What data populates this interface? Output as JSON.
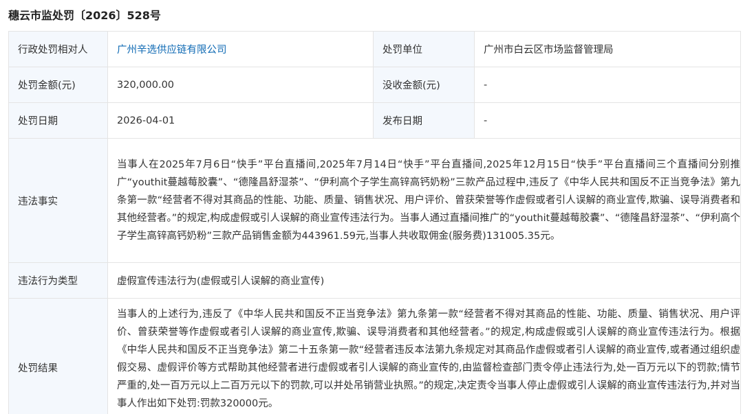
{
  "page_title": "穗云市监处罚〔2026〕528号",
  "rows": {
    "party_label": "行政处罚相对人",
    "party_value": "广州辛选供应链有限公司",
    "unit_label": "处罚单位",
    "unit_value": "广州市白云区市场监督管理局",
    "amount_label": "处罚金额(元)",
    "amount_value": "320,000.00",
    "confiscation_label": "没收金额(元)",
    "confiscation_value": "-",
    "date_label": "处罚日期",
    "date_value": "2026-04-01",
    "publish_label": "发布日期",
    "publish_value": "-",
    "facts_label": "违法事实",
    "facts_value": "当事人在2025年7月6日“快手”平台直播间,2025年7月14日“快手”平台直播间,2025年12月15日“快手”平台直播间三个直播间分别推广“youthit蔓越莓胶囊”、“德隆昌舒湿茶”、“伊利高个子学生高锌高钙奶粉”三款产品过程中,违反了《中华人民共和国反不正当竞争法》第九条第一款“经营者不得对其商品的性能、功能、质量、销售状况、用户评价、曾获荣誉等作虚假或者引人误解的商业宣传,欺骗、误导消费者和其他经营者。”的规定,构成虚假或引人误解的商业宣传违法行为。当事人通过直播间推广的“youthit蔓越莓胶囊”、“德隆昌舒湿茶”、“伊利高个子学生高锌高钙奶粉”三款产品销售金额为443961.59元,当事人共收取佣金(服务费)131005.35元。",
    "type_label": "违法行为类型",
    "type_value": "虚假宣传违法行为(虚假或引人误解的商业宣传)",
    "result_label": "处罚结果",
    "result_value": "当事人的上述行为,违反了《中华人民共和国反不正当竞争法》第九条第一款“经营者不得对其商品的性能、功能、质量、销售状况、用户评价、曾获荣誉等作虚假或者引人误解的商业宣传,欺骗、误导消费者和其他经营者。”的规定,构成虚假或引人误解的商业宣传违法行为。根据《中华人民共和国反不正当竞争法》第二十五条第一款“经营者违反本法第九条规定对其商品作虚假或者引人误解的商业宣传,或者通过组织虚假交易、虚假评价等方式帮助其他经营者进行虚假或者引人误解的商业宣传的,由监督检查部门责令停止违法行为,处一百万元以下的罚款;情节严重的,处一百万元以上二百万元以下的罚款,可以并处吊销营业执照。”的规定,决定责令当事人停止虚假或引人误解的商业宣传违法行为,并对当事人作出如下处罚:罚款320000元。"
  }
}
